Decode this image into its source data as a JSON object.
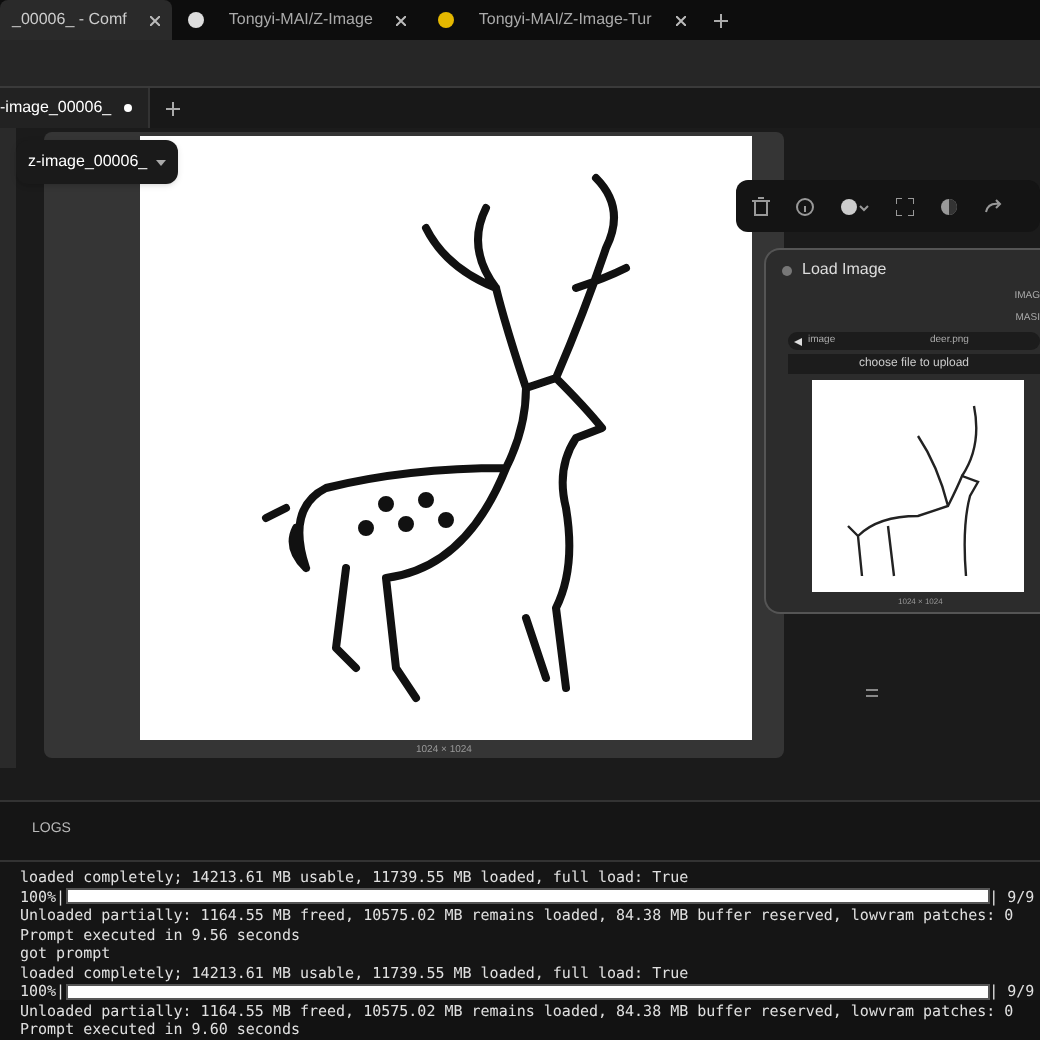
{
  "browser_tabs": [
    {
      "label": "_00006_ - Comf",
      "selected": true
    },
    {
      "label": "Tongyi-MAI/Z-Image",
      "selected": false
    },
    {
      "label": "Tongyi-MAI/Z-Image-Tur",
      "selected": false
    }
  ],
  "workflow_tabs": [
    {
      "label": "-image_00006_",
      "unsaved": true,
      "selected": true
    }
  ],
  "preview": {
    "dropdown": "z-image_00006_",
    "size": "1024 × 1024"
  },
  "load_image_node": {
    "title": "Load Image",
    "outputs": [
      "IMAG",
      "MASI"
    ],
    "widget": {
      "label": "image",
      "value": "deer.png"
    },
    "upload_button": "choose file to upload",
    "size": "1024 × 1024"
  },
  "logs": {
    "title": "LOGS",
    "lines": [
      {
        "kind": "text",
        "text": "loaded completely; 14213.61 MB usable, 11739.55 MB loaded, full load: True"
      },
      {
        "kind": "progress",
        "prefix": "100%|",
        "suffix": "| 9/9",
        "level": 1
      },
      {
        "kind": "text",
        "text": "Unloaded partially: 1164.55 MB freed, 10575.02 MB remains loaded, 84.38 MB buffer reserved, lowvram patches: 0"
      },
      {
        "kind": "text",
        "text": "Prompt executed in 9.56 seconds"
      },
      {
        "kind": "text",
        "text": "got prompt"
      },
      {
        "kind": "text",
        "text": "loaded completely; 14213.61 MB usable, 11739.55 MB loaded, full load: True"
      },
      {
        "kind": "progress",
        "prefix": "100%|",
        "suffix": "| 9/9",
        "level": 1
      },
      {
        "kind": "text",
        "text": "Unloaded partially: 1164.55 MB freed, 10575.02 MB remains loaded, 84.38 MB buffer reserved, lowvram patches: 0"
      },
      {
        "kind": "text",
        "text": "Prompt executed in 9.60 seconds"
      }
    ]
  }
}
